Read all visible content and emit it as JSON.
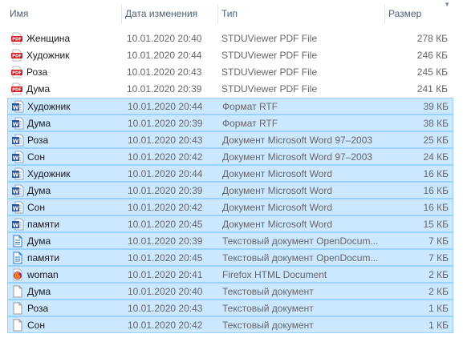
{
  "columns": {
    "name": "Имя",
    "date": "Дата изменения",
    "type": "Тип",
    "size": "Размер"
  },
  "files": [
    {
      "name": "Женщина",
      "date": "10.01.2020 20:40",
      "type": "STDUViewer PDF File",
      "size": "278 КБ",
      "icon": "pdf-file-icon",
      "selected": false
    },
    {
      "name": "Художник",
      "date": "10.01.2020 20:44",
      "type": "STDUViewer PDF File",
      "size": "246 КБ",
      "icon": "pdf-file-icon",
      "selected": false
    },
    {
      "name": "Роза",
      "date": "10.01.2020 20:43",
      "type": "STDUViewer PDF File",
      "size": "245 КБ",
      "icon": "pdf-file-icon",
      "selected": false
    },
    {
      "name": "Дума",
      "date": "10.01.2020 20:39",
      "type": "STDUViewer PDF File",
      "size": "241 КБ",
      "icon": "pdf-file-icon",
      "selected": false
    },
    {
      "name": "Художник",
      "date": "10.01.2020 20:44",
      "type": "Формат RTF",
      "size": "39 КБ",
      "icon": "word-file-icon",
      "selected": true
    },
    {
      "name": "Дума",
      "date": "10.01.2020 20:39",
      "type": "Формат RTF",
      "size": "38 КБ",
      "icon": "word-file-icon",
      "selected": true
    },
    {
      "name": "Роза",
      "date": "10.01.2020 20:43",
      "type": "Документ Microsoft Word 97–2003",
      "size": "25 КБ",
      "icon": "word-file-icon",
      "selected": true
    },
    {
      "name": "Сон",
      "date": "10.01.2020 20:42",
      "type": "Документ Microsoft Word 97–2003",
      "size": "24 КБ",
      "icon": "word-file-icon",
      "selected": true
    },
    {
      "name": "Художник",
      "date": "10.01.2020 20:44",
      "type": "Документ Microsoft Word",
      "size": "16 КБ",
      "icon": "word-file-icon",
      "selected": true
    },
    {
      "name": "Дума",
      "date": "10.01.2020 20:39",
      "type": "Документ Microsoft Word",
      "size": "16 КБ",
      "icon": "word-file-icon",
      "selected": true
    },
    {
      "name": "Сон",
      "date": "10.01.2020 20:42",
      "type": "Документ Microsoft Word",
      "size": "16 КБ",
      "icon": "word-file-icon",
      "selected": true
    },
    {
      "name": "памяти",
      "date": "10.01.2020 20:45",
      "type": "Документ Microsoft Word",
      "size": "15 КБ",
      "icon": "word-file-icon",
      "selected": true
    },
    {
      "name": "Дума",
      "date": "10.01.2020 20:39",
      "type": "Текстовый документ OpenDocum...",
      "size": "7 КБ",
      "icon": "odt-file-icon",
      "selected": true
    },
    {
      "name": "памяти",
      "date": "10.01.2020 20:45",
      "type": "Текстовый документ OpenDocum...",
      "size": "7 КБ",
      "icon": "odt-file-icon",
      "selected": true
    },
    {
      "name": "woman",
      "date": "10.01.2020 20:41",
      "type": "Firefox HTML Document",
      "size": "2 КБ",
      "icon": "firefox-html-icon",
      "selected": true
    },
    {
      "name": "Дума",
      "date": "10.01.2020 20:40",
      "type": "Текстовый документ",
      "size": "2 КБ",
      "icon": "text-file-icon",
      "selected": true
    },
    {
      "name": "Роза",
      "date": "10.01.2020 20:43",
      "type": "Текстовый документ",
      "size": "1 КБ",
      "icon": "text-file-icon",
      "selected": true
    },
    {
      "name": "Сон",
      "date": "10.01.2020 20:42",
      "type": "Текстовый документ",
      "size": "1 КБ",
      "icon": "text-file-icon",
      "selected": true
    }
  ]
}
